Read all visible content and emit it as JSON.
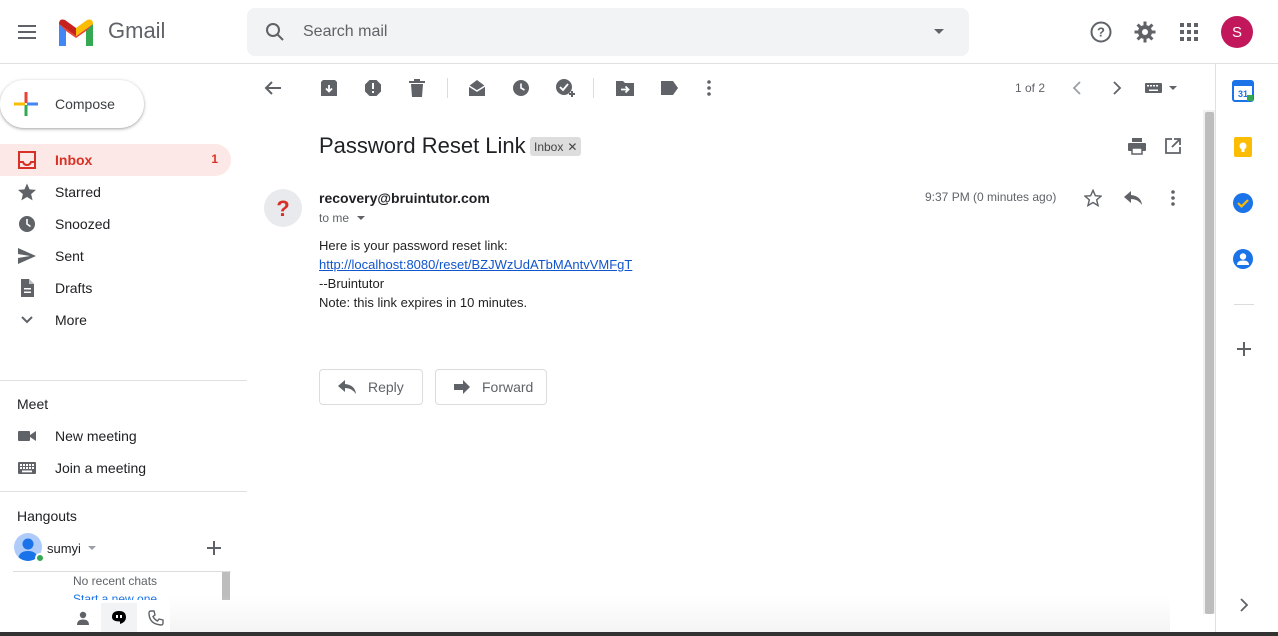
{
  "header": {
    "app_name": "Gmail",
    "search_placeholder": "Search mail",
    "avatar_letter": "S"
  },
  "sidebar": {
    "compose_label": "Compose",
    "items": [
      {
        "label": "Inbox",
        "count": "1",
        "icon": "inbox-icon"
      },
      {
        "label": "Starred",
        "icon": "star-icon"
      },
      {
        "label": "Snoozed",
        "icon": "clock-icon"
      },
      {
        "label": "Sent",
        "icon": "send-icon"
      },
      {
        "label": "Drafts",
        "icon": "draft-icon"
      },
      {
        "label": "More",
        "icon": "chevron-down-icon"
      }
    ],
    "meet": {
      "title": "Meet",
      "items": [
        {
          "label": "New meeting",
          "icon": "video-camera-icon"
        },
        {
          "label": "Join a meeting",
          "icon": "keyboard-icon"
        }
      ]
    },
    "hangouts": {
      "title": "Hangouts",
      "user_name": "sumyi",
      "no_chats": "No recent chats",
      "start_new": "Start a new one"
    }
  },
  "toolbar": {
    "pager": "1 of 2"
  },
  "email": {
    "subject": "Password Reset Link",
    "label": "Inbox",
    "sender": "recovery@bruintutor.com",
    "to": "to me",
    "time": "9:37 PM (0 minutes ago)",
    "body": [
      "Here is your password reset link:",
      "http://localhost:8080/reset/BZJWzUdATbMAntvVMFgT",
      "--Bruintutor",
      "Note: this link expires in 10 minutes."
    ],
    "reply_label": "Reply",
    "forward_label": "Forward"
  },
  "colors": {
    "accent_red": "#d93025",
    "inbox_highlight": "#fce8e6",
    "link_blue": "#1155cc",
    "avatar_bg": "#c2185b"
  }
}
